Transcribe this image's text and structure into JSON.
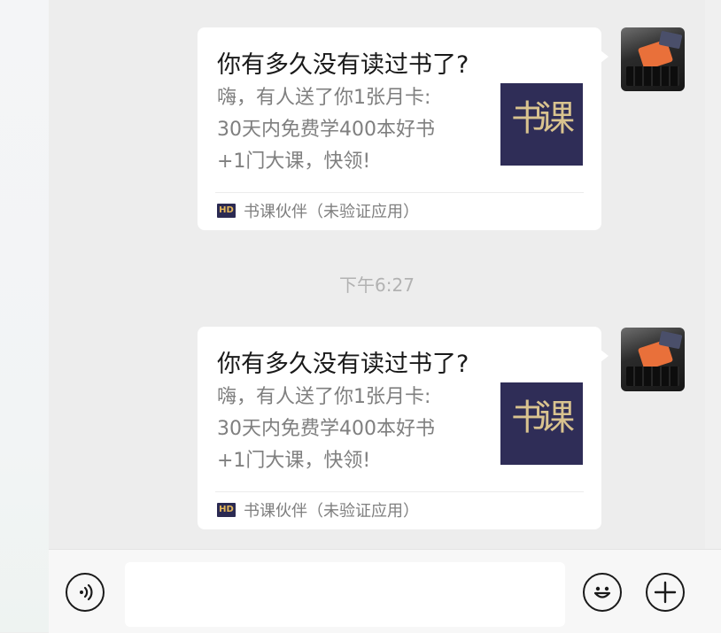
{
  "messages": [
    {
      "title": "你有多久没有读过书了?",
      "description": "嗨，有人送了你1张月卡:\n30天内免费学400本好书\n+1门大课，快领!",
      "thumb_text": "书课",
      "app_logo": "HD",
      "app_name": "书课伙伴（未验证应用）"
    },
    {
      "title": "你有多久没有读过书了?",
      "description": "嗨，有人送了你1张月卡:\n30天内免费学400本好书\n+1门大课，快领!",
      "thumb_text": "书课",
      "app_logo": "HD",
      "app_name": "书课伙伴（未验证应用）"
    }
  ],
  "timestamp": "下午6:27",
  "input": {
    "value": "",
    "placeholder": ""
  },
  "icons": {
    "voice": "voice-icon",
    "emoji": "emoji-icon",
    "plus": "plus-icon"
  },
  "colors": {
    "background": "#ededed",
    "card": "#ffffff",
    "thumb": "#2f2d57",
    "timestamp": "#b2b2b2"
  }
}
